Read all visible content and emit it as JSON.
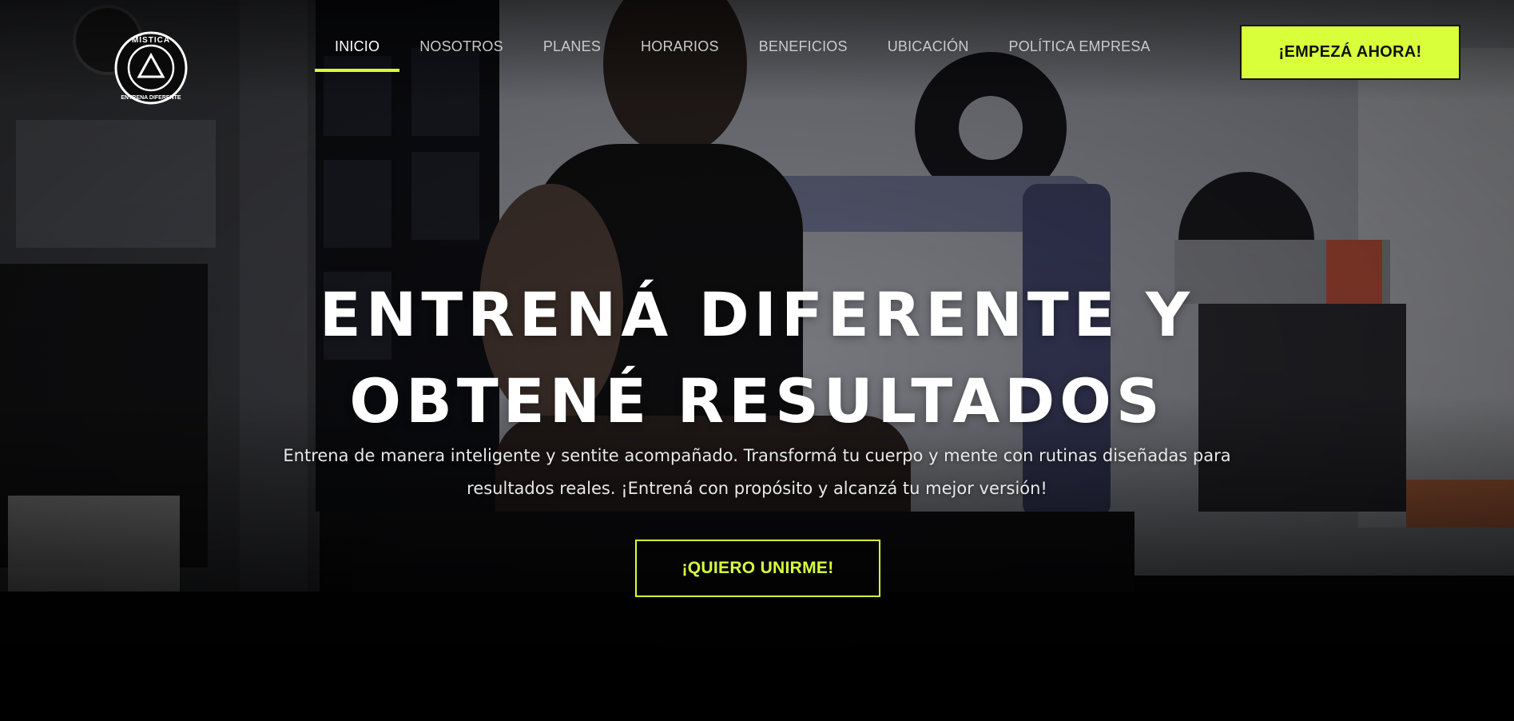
{
  "brand": {
    "logo_icon": "triangle-circle-emblem",
    "logo_text_top": "MÍSTICA",
    "logo_text_bottom": "ENTRENA DIFERENTE"
  },
  "nav": {
    "items": [
      {
        "label": "INICIO",
        "active": true
      },
      {
        "label": "NOSOTROS",
        "active": false
      },
      {
        "label": "PLANES",
        "active": false
      },
      {
        "label": "HORARIOS",
        "active": false
      },
      {
        "label": "BENEFICIOS",
        "active": false
      },
      {
        "label": "UBICACIÓN",
        "active": false
      },
      {
        "label": "POLÍTICA EMPRESA",
        "active": false
      }
    ]
  },
  "header_cta": {
    "label": "¡EMPEZÁ AHORA!"
  },
  "hero": {
    "title_line1": "ENTRENÁ DIFERENTE Y",
    "title_line2": "OBTENÉ RESULTADOS",
    "subtitle_line1": "Entrena de manera inteligente y sentite acompañado. Transformá tu cuerpo y mente con rutinas diseñadas para",
    "subtitle_line2": "resultados reales. ¡Entrená con propósito y alcanzá tu mejor versión!",
    "cta_label": "¡QUIERO UNIRME!",
    "background_image": "gym-athlete-on-machine"
  },
  "colors": {
    "accent": "#d9ff3b",
    "text": "#ffffff",
    "nav_text": "#c9c9c9",
    "background": "#050505"
  }
}
